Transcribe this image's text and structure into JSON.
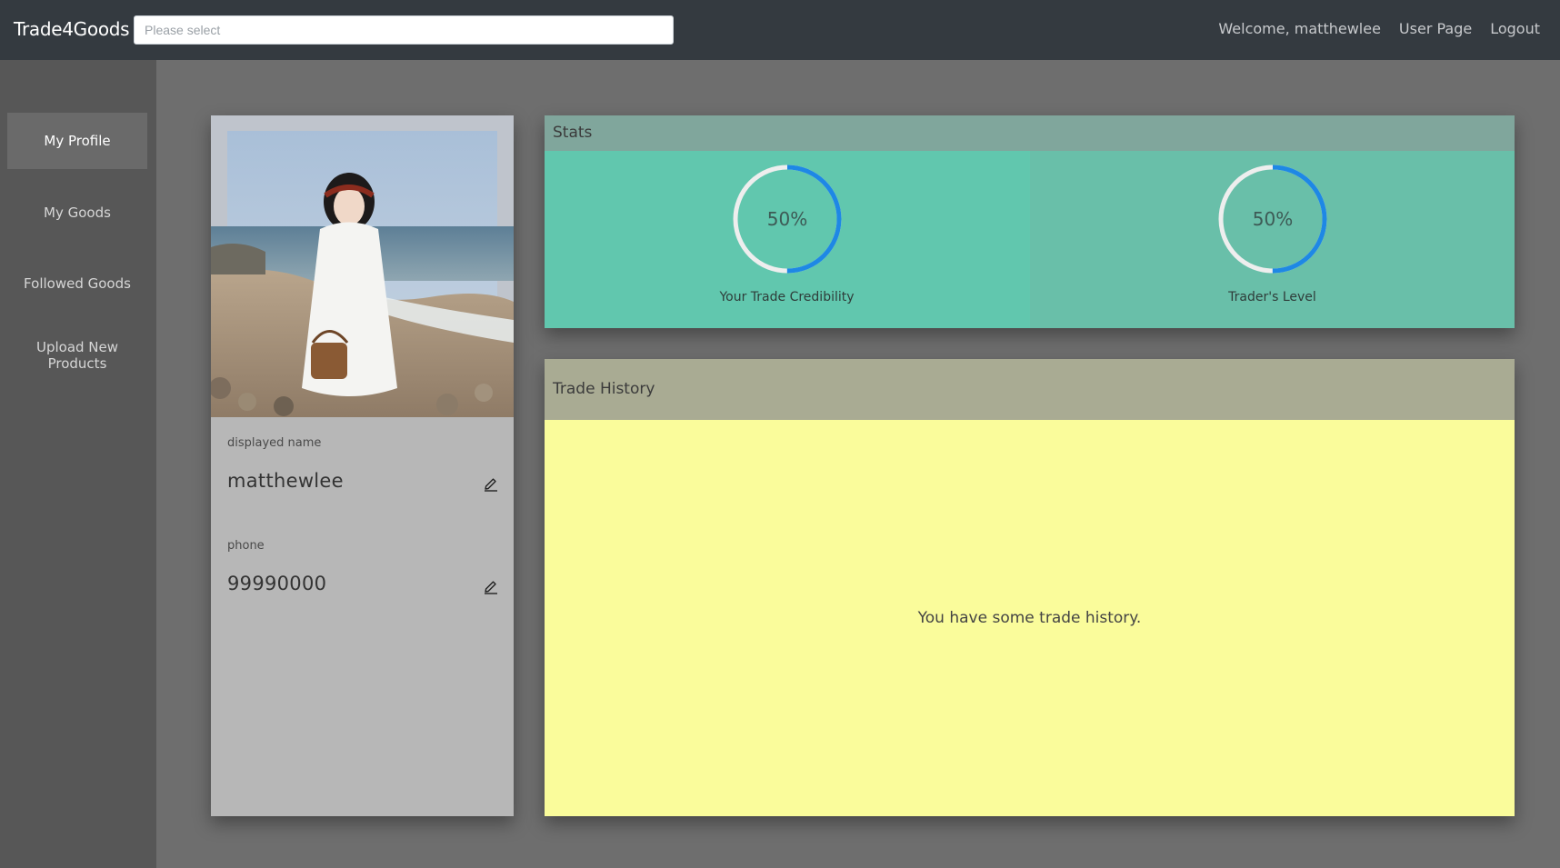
{
  "app": {
    "brand": "Trade4Goods"
  },
  "search": {
    "placeholder": "Please select",
    "value": ""
  },
  "nav": {
    "welcome": "Welcome, matthewlee",
    "user_page": "User Page",
    "logout": "Logout"
  },
  "sidebar": {
    "items": [
      {
        "label": "My Profile",
        "active": true
      },
      {
        "label": "My Goods",
        "active": false
      },
      {
        "label": "Followed Goods",
        "active": false
      },
      {
        "label": "Upload New Products",
        "active": false
      }
    ]
  },
  "profile": {
    "display_name_label": "displayed name",
    "display_name": "matthewlee",
    "phone_label": "phone",
    "phone": "99990000",
    "edit_icon": "pencil-icon"
  },
  "stats": {
    "title": "Stats",
    "items": [
      {
        "value_text": "50%",
        "progress": 0.5,
        "label": "Your Trade Credibility"
      },
      {
        "value_text": "50%",
        "progress": 0.5,
        "label": "Trader's Level"
      }
    ],
    "ring_color": "#1e88e5",
    "ring_track_color": "#eeeeee"
  },
  "history": {
    "title": "Trade History",
    "message": "You have some trade history."
  },
  "colors": {
    "topbar": "#343a40",
    "sidebar": "#575757",
    "stats_bg": "#62c7ae",
    "history_bg": "#fafc9b"
  }
}
